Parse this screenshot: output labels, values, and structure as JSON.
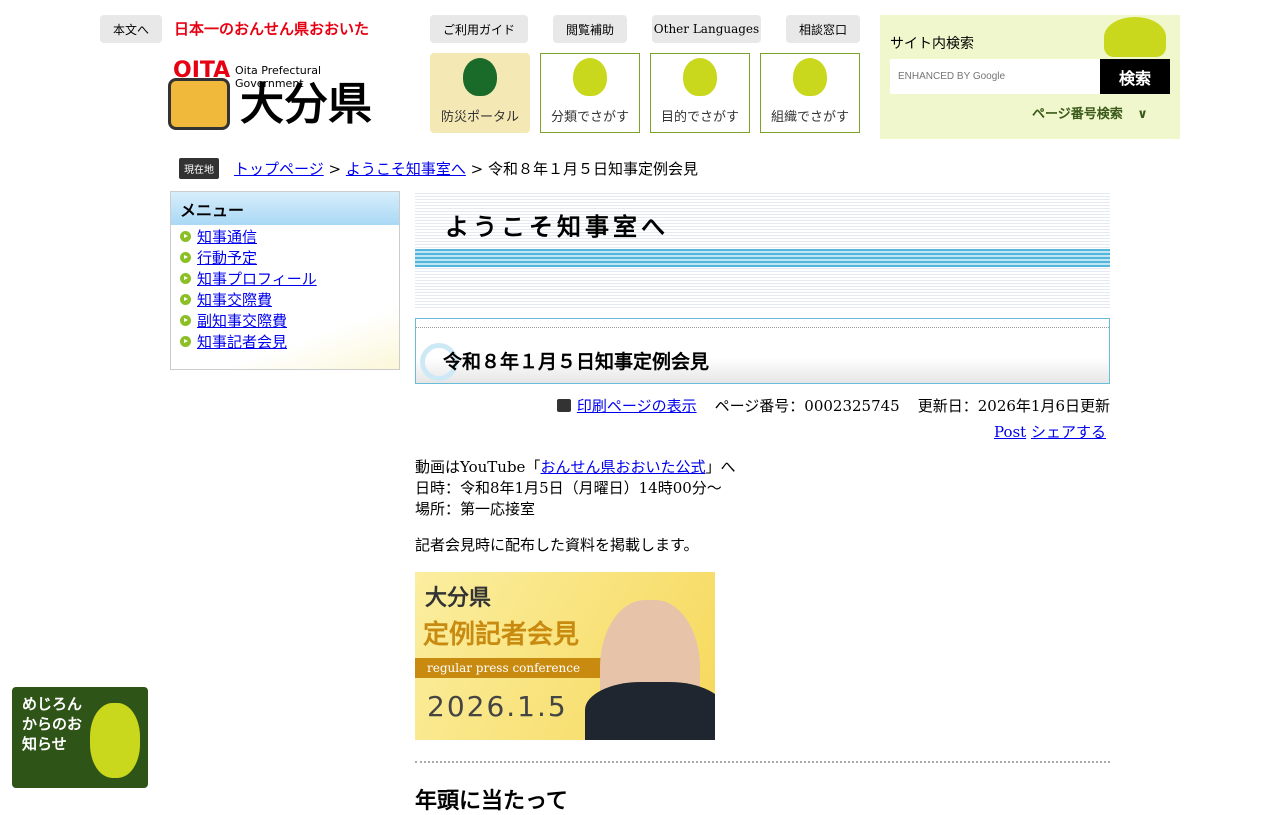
{
  "header": {
    "skip_link": "本文へ",
    "onsen_slogan": "日本一のおんせん県おおいた",
    "logo_en": "Oita Prefectural Government",
    "logo_jp": "大分県",
    "utility": [
      "ご利用ガイド",
      "閲覧補助",
      "Other Languages",
      "相談窓口"
    ],
    "nav": [
      "防災ポータル",
      "分類でさがす",
      "目的でさがす",
      "組織でさがす"
    ]
  },
  "search": {
    "title": "サイト内検索",
    "placeholder": "ENHANCED BY Google",
    "button": "検索",
    "page_number_search": "ページ番号検索"
  },
  "breadcrumb": {
    "badge": "現在地",
    "items": [
      "トップページ",
      "ようこそ知事室へ"
    ],
    "current": "令和８年１月５日知事定例会見",
    "sep": " > "
  },
  "sidebar": {
    "title": "メニュー",
    "items": [
      "知事通信",
      "行動予定",
      "知事プロフィール",
      "知事交際費",
      "副知事交際費",
      "知事記者会見"
    ]
  },
  "main": {
    "banner": "ようこそ知事室へ",
    "title": "令和８年１月５日知事定例会見",
    "print_link": "印刷ページの表示",
    "page_no": "ページ番号：0002325745",
    "updated": "更新日：2026年1月6日更新",
    "post": "Post",
    "share": "シェアする",
    "video_prefix": "動画はYouTube「",
    "video_link": "おんせん県おおいた公式",
    "video_suffix": "」へ",
    "datetime": "日時：令和8年1月5日（月曜日）14時00分～",
    "place": "場所：第一応接室",
    "note": "記者会見時に配布した資料を掲載します。",
    "image": {
      "pref": "大分県",
      "title": "定例記者会見",
      "sub": "regular press conference",
      "date": "2026.1.5"
    },
    "next_heading": "年頭に当たって"
  },
  "mejiron": "めじろんからのお知らせ"
}
